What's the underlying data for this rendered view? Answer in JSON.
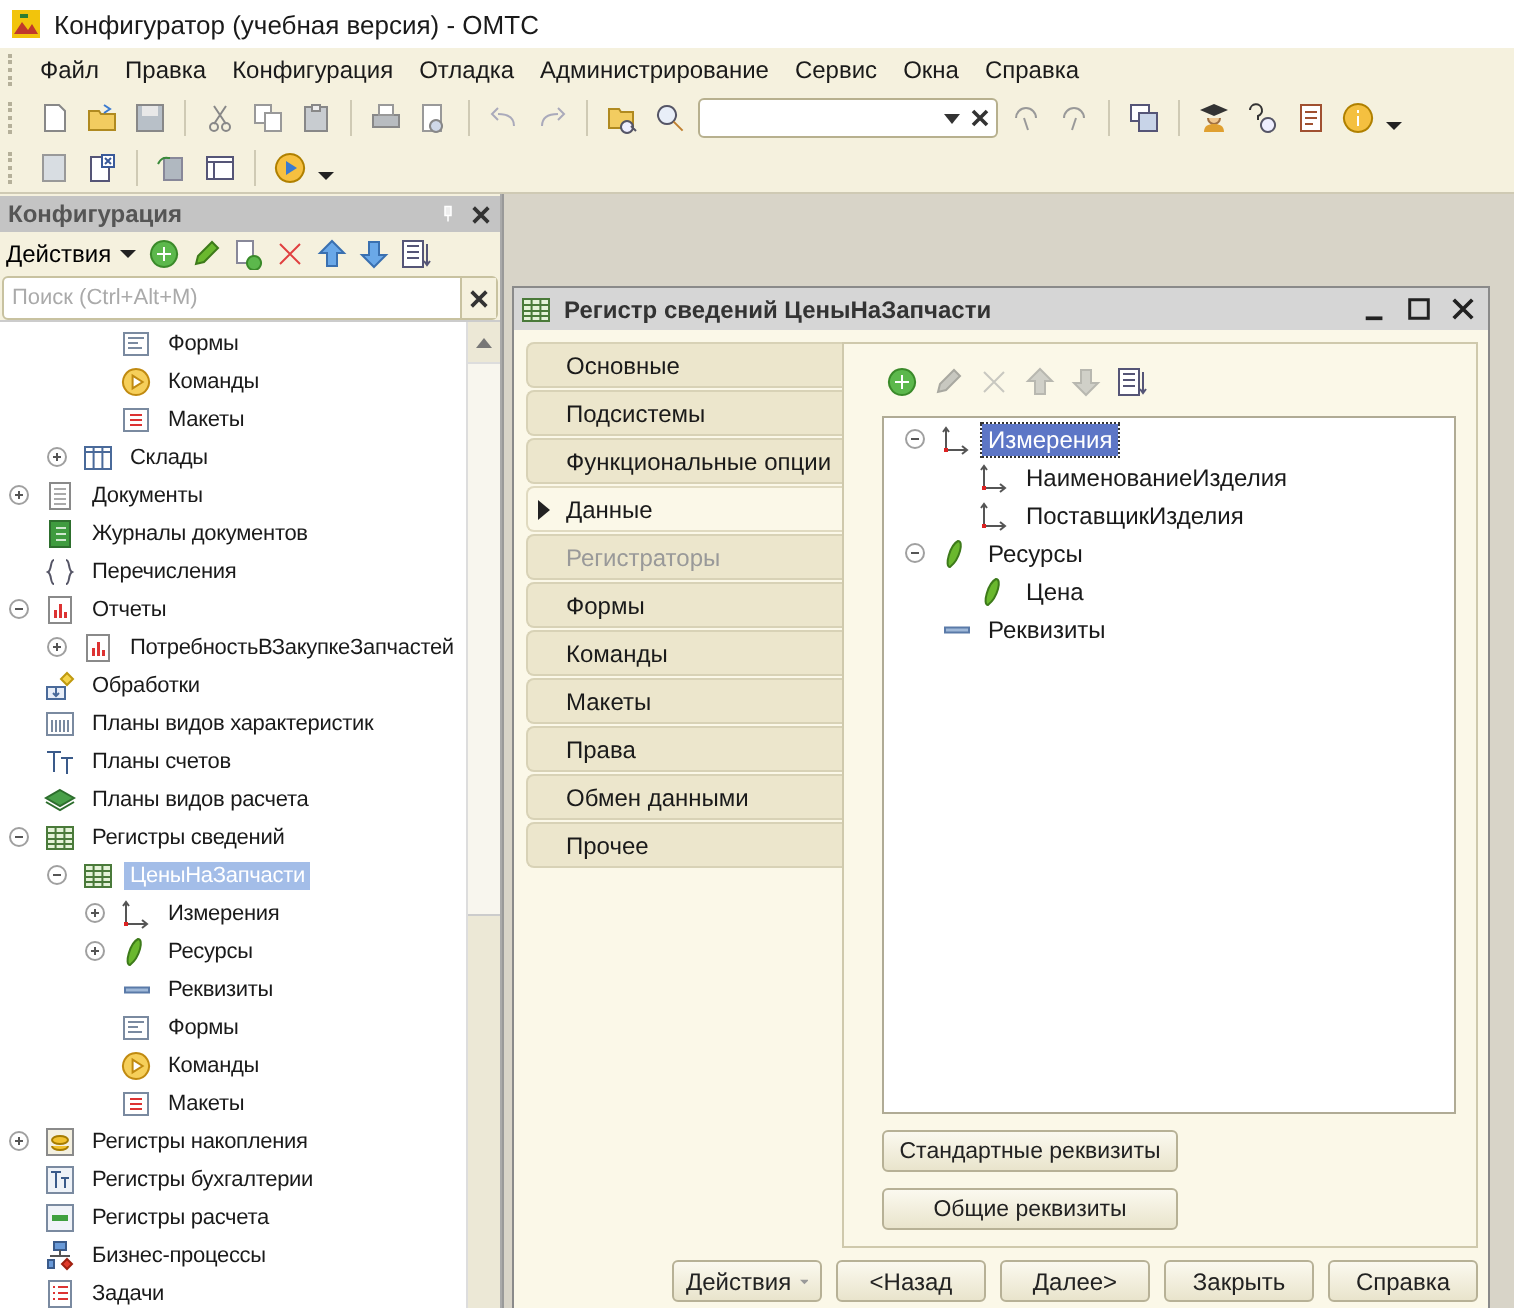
{
  "window": {
    "title": "Конфигуратор (учебная версия) - ОМТС"
  },
  "menu": [
    "Файл",
    "Правка",
    "Конфигурация",
    "Отладка",
    "Администрирование",
    "Сервис",
    "Окна",
    "Справка"
  ],
  "config_panel": {
    "title": "Конфигурация",
    "actions_menu": "Действия",
    "search": {
      "placeholder": "Поиск (Ctrl+Alt+M)"
    },
    "tree": [
      {
        "children": [
          {
            "children": [
              {
                "label": "Формы",
                "kind": "form",
                "selected": false
              },
              {
                "label": "Команды",
                "kind": "command",
                "selected": false
              },
              {
                "label": "Макеты",
                "kind": "template",
                "selected": false
              }
            ]
          },
          {
            "label": "Склады",
            "kind": "catalog",
            "expanded": false,
            "selected": false
          }
        ]
      },
      {
        "label": "Документы",
        "kind": "document",
        "expanded": false,
        "selected": false
      },
      {
        "label": "Журналы документов",
        "kind": "journal",
        "selected": false
      },
      {
        "label": "Перечисления",
        "kind": "enum",
        "selected": false
      },
      {
        "label": "Отчеты",
        "kind": "report",
        "expanded": true,
        "selected": false,
        "children": [
          {
            "label": "ПотребностьВЗакупкеЗапчастей",
            "kind": "report",
            "expanded": false,
            "selected": false
          }
        ]
      },
      {
        "label": "Обработки",
        "kind": "processing",
        "selected": false
      },
      {
        "label": "Планы видов характеристик",
        "kind": "chars",
        "selected": false
      },
      {
        "label": "Планы счетов",
        "kind": "accounts",
        "selected": false
      },
      {
        "label": "Планы видов расчета",
        "kind": "calc-kinds",
        "selected": false
      },
      {
        "label": "Регистры сведений",
        "kind": "info-register",
        "expanded": true,
        "selected": false,
        "children": [
          {
            "label": "ЦеныНаЗапчасти",
            "kind": "info-register",
            "expanded": true,
            "selected": true,
            "children": [
              {
                "label": "Измерения",
                "kind": "dimension",
                "expanded": false,
                "selected": false
              },
              {
                "label": "Ресурсы",
                "kind": "resource",
                "expanded": false,
                "selected": false
              },
              {
                "label": "Реквизиты",
                "kind": "attribute",
                "selected": false
              },
              {
                "label": "Формы",
                "kind": "form",
                "selected": false
              },
              {
                "label": "Команды",
                "kind": "command",
                "selected": false
              },
              {
                "label": "Макеты",
                "kind": "template",
                "selected": false
              }
            ]
          }
        ]
      },
      {
        "label": "Регистры накопления",
        "kind": "accum-register",
        "expanded": false,
        "selected": false
      },
      {
        "label": "Регистры бухгалтерии",
        "kind": "acc-register",
        "selected": false
      },
      {
        "label": "Регистры расчета",
        "kind": "calc-register",
        "selected": false
      },
      {
        "label": "Бизнес-процессы",
        "kind": "business-process",
        "selected": false
      },
      {
        "label": "Задачи",
        "kind": "task",
        "selected": false
      }
    ]
  },
  "dialog": {
    "title": "Регистр сведений ЦеныНаЗапчасти",
    "tabs": [
      {
        "label": "Основные",
        "selected": false,
        "disabled": false
      },
      {
        "label": "Подсистемы",
        "selected": false,
        "disabled": false
      },
      {
        "label": "Функциональные опции",
        "selected": false,
        "disabled": false
      },
      {
        "label": "Данные",
        "selected": true,
        "disabled": false
      },
      {
        "label": "Регистраторы",
        "selected": false,
        "disabled": true
      },
      {
        "label": "Формы",
        "selected": false,
        "disabled": false
      },
      {
        "label": "Команды",
        "selected": false,
        "disabled": false
      },
      {
        "label": "Макеты",
        "selected": false,
        "disabled": false
      },
      {
        "label": "Права",
        "selected": false,
        "disabled": false
      },
      {
        "label": "Обмен данными",
        "selected": false,
        "disabled": false
      },
      {
        "label": "Прочее",
        "selected": false,
        "disabled": false
      }
    ],
    "tree": [
      {
        "label": "Измерения",
        "kind": "dimension",
        "expanded": true,
        "selected": true,
        "children": [
          {
            "label": "НаименованиеИзделия",
            "kind": "dimension",
            "selected": false
          },
          {
            "label": "ПоставщикИзделия",
            "kind": "dimension",
            "selected": false
          }
        ]
      },
      {
        "label": "Ресурсы",
        "kind": "resource",
        "expanded": true,
        "selected": false,
        "children": [
          {
            "label": "Цена",
            "kind": "resource",
            "selected": false
          }
        ]
      },
      {
        "label": "Реквизиты",
        "kind": "attribute",
        "selected": false
      }
    ],
    "side_buttons": [
      "Стандартные реквизиты",
      "Общие реквизиты"
    ],
    "footer": {
      "actions_menu": "Действия",
      "buttons": [
        "<Назад",
        "Далее>",
        "Закрыть",
        "Справка"
      ]
    }
  }
}
